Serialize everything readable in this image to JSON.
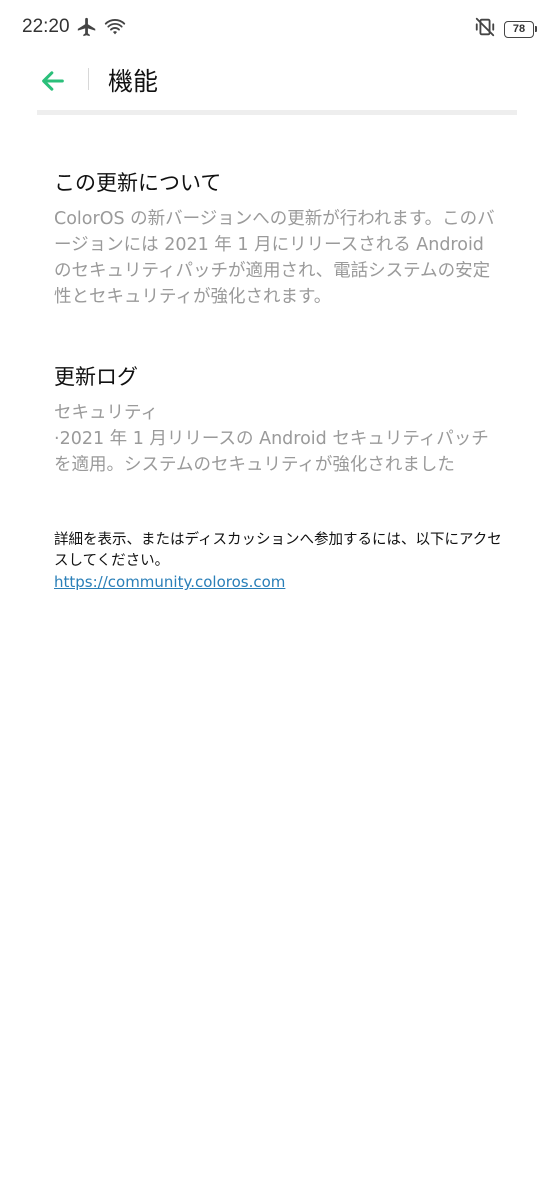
{
  "status_bar": {
    "time": "22:20",
    "left_icons": [
      "airplane-icon",
      "wifi-icon"
    ],
    "right_icons": [
      "vibrate-off-icon"
    ],
    "battery_level": "78"
  },
  "app_bar": {
    "back_icon": "back-arrow-icon",
    "title": "機能"
  },
  "sections": [
    {
      "heading": "この更新について",
      "body": "ColorOS の新バージョンへの更新が行われます。このバージョンには 2021 年 1 月にリリースされる Android のセキュリティパッチが適用され、電話システムの安定性とセキュリティが強化されます。"
    },
    {
      "heading": "更新ログ",
      "body_line1": "セキュリティ",
      "body_line2": "·2021 年 1 月リリースの Android セキュリティパッチを適用。システムのセキュリティが強化されました"
    }
  ],
  "note": {
    "text": "詳細を表示、またはディスカッションへ参加するには、以下にアクセスしてください。",
    "link": "https://community.coloros.com"
  },
  "colors": {
    "accent": "#2bbf7a",
    "link": "#2a7fb8",
    "secondary_text": "#9a9a9a"
  }
}
